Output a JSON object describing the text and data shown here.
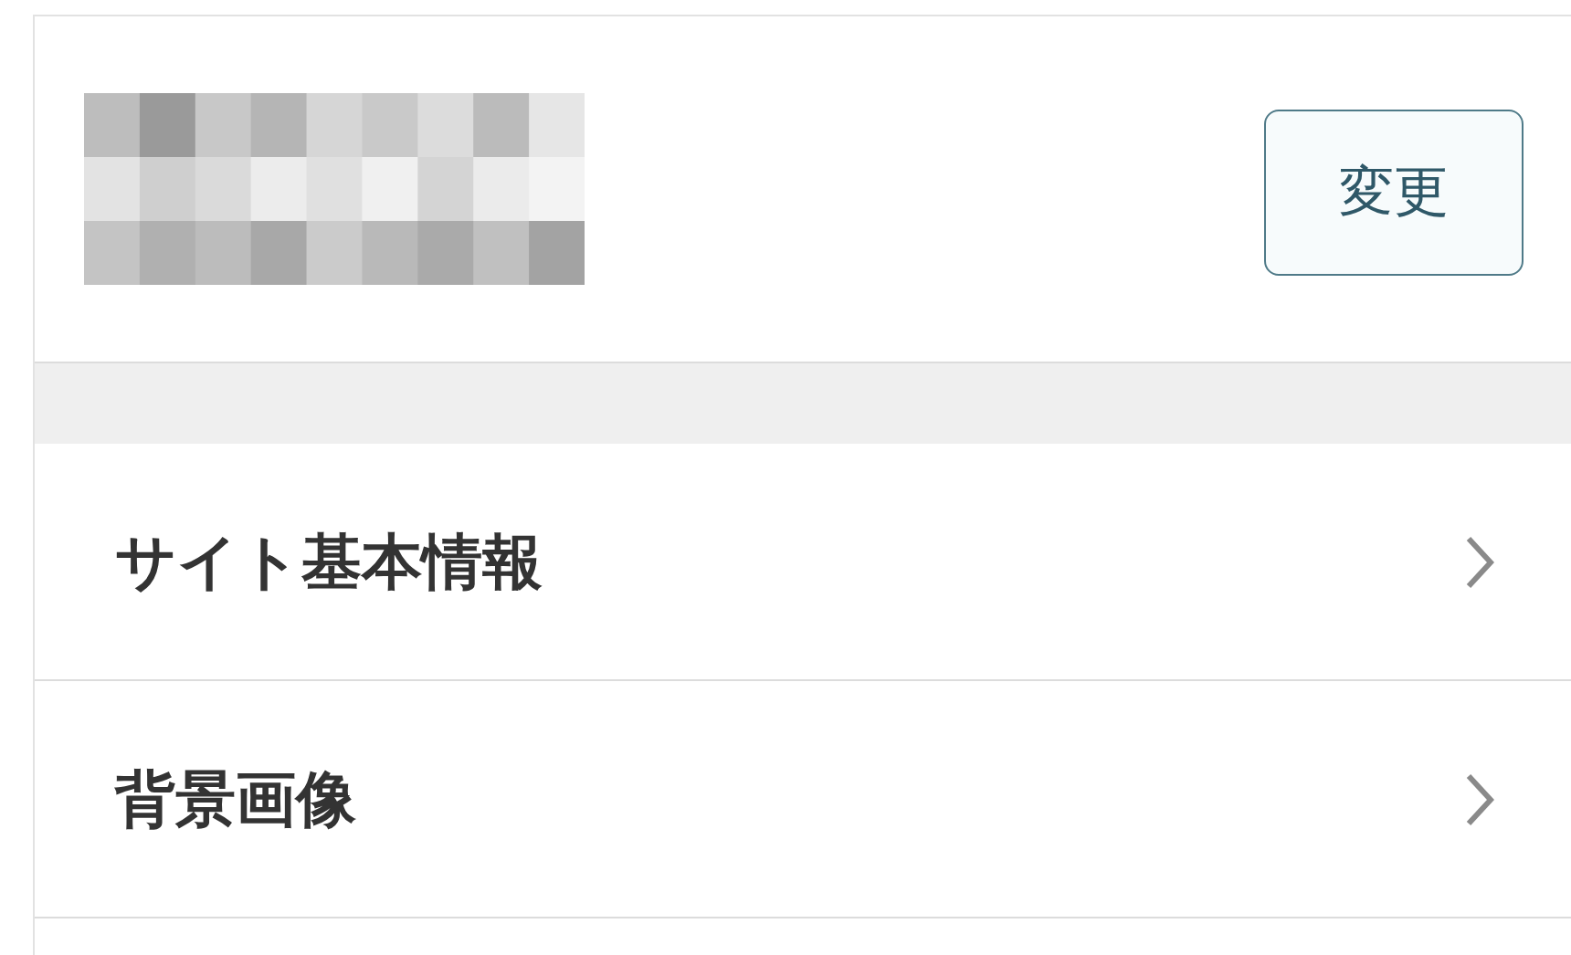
{
  "header": {
    "button": "変更"
  },
  "menu": [
    {
      "label": "サイト基本情報"
    },
    {
      "label": "背景画像"
    }
  ]
}
